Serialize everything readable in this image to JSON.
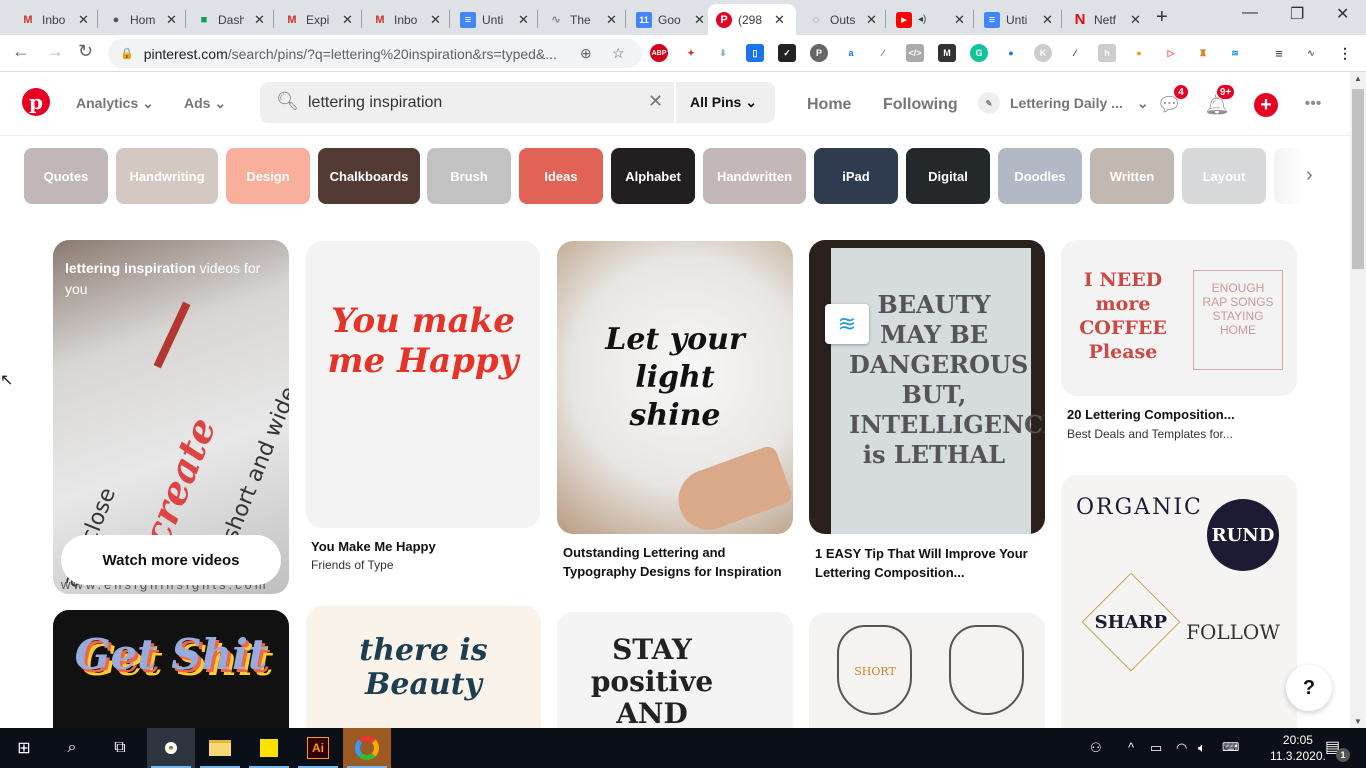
{
  "browser": {
    "tabs": [
      {
        "title": "Inbo",
        "icon": "gmail-icon"
      },
      {
        "title": "Hom",
        "icon": "globe-icon"
      },
      {
        "title": "Dash",
        "icon": "chat-icon"
      },
      {
        "title": "Expi",
        "icon": "gmail-icon"
      },
      {
        "title": "Inbo",
        "icon": "gmail-icon"
      },
      {
        "title": "Unti",
        "icon": "docs-icon"
      },
      {
        "title": "The",
        "icon": "site-icon"
      },
      {
        "title": "Goo",
        "icon": "calendar-icon"
      },
      {
        "title": "(298",
        "icon": "pinterest-icon",
        "active": true
      },
      {
        "title": "Outs",
        "icon": "loading-icon"
      },
      {
        "title": "",
        "icon": "youtube-icon",
        "audio": true
      },
      {
        "title": "Unti",
        "icon": "docs-icon"
      },
      {
        "title": "Netf",
        "icon": "netflix-icon"
      }
    ],
    "calendar_day": "11",
    "url_host": "pinterest.com",
    "url_path": "/search/pins/?q=lettering%20inspiration&rs=typed&...",
    "extensions": [
      "ABP",
      "extension",
      "download",
      "extension",
      "check",
      "pinterest",
      "extension",
      "eyedropper",
      "code",
      "M",
      "G",
      "cookie",
      "K",
      "picker",
      "h",
      "sync",
      "play",
      "extension",
      "wave"
    ]
  },
  "header": {
    "menu": [
      {
        "label": "Analytics"
      },
      {
        "label": "Ads"
      }
    ],
    "search_value": "lettering inspiration",
    "search_scope": "All Pins",
    "nav": [
      {
        "label": "Home"
      },
      {
        "label": "Following"
      }
    ],
    "account": "Lettering Daily ...",
    "messages_badge": "4",
    "notifications_badge": "9+"
  },
  "guides": [
    {
      "label": "Quotes",
      "color": "#c1b7b9"
    },
    {
      "label": "Handwriting",
      "color": "#d3c9c2"
    },
    {
      "label": "Design",
      "color": "#f8b09c"
    },
    {
      "label": "Chalkboards",
      "color": "#533a34"
    },
    {
      "label": "Brush",
      "color": "#c2c2c2"
    },
    {
      "label": "Ideas",
      "color": "#e06355"
    },
    {
      "label": "Alphabet",
      "color": "#231f20"
    },
    {
      "label": "Handwritten",
      "color": "#c3b7b7"
    },
    {
      "label": "iPad",
      "color": "#2f3c4f"
    },
    {
      "label": "Digital",
      "color": "#23282b"
    },
    {
      "label": "Doodles",
      "color": "#b3b8c6"
    },
    {
      "label": "Written",
      "color": "#c0b8b1"
    },
    {
      "label": "Layout",
      "color": "#d6d8d9"
    }
  ],
  "pins": {
    "video_card": {
      "title_bold": "lettering inspiration",
      "title_rest": " videos for you",
      "button": "Watch more videos",
      "image_text": [
        "tall and close",
        "create",
        "short and wide"
      ],
      "watermark": "www.ensigninsights.com"
    },
    "items": [
      {
        "title": "You Make Me Happy",
        "subtitle": "Friends of Type",
        "art": "You make me Happy"
      },
      {
        "title": "Outstanding Lettering and Typography Designs for Inspiration",
        "subtitle": "",
        "art": "Let your light shine"
      },
      {
        "title": "1 EASY Tip That Will Improve Your Lettering Composition...",
        "subtitle": "",
        "art": "BEAUTY MAY BE DANGEROUS BUT, INTELLIGENCE is LETHAL"
      },
      {
        "title": "20 Lettering Composition...",
        "subtitle": "Best Deals and Templates for...",
        "art": "I NEED more COFFEE Please"
      },
      {
        "title": "",
        "subtitle": "",
        "art": "ORGANIC ROUND SHARP FOLLOW"
      },
      {
        "title": "",
        "subtitle": "",
        "art": "Get Shit"
      },
      {
        "title": "",
        "subtitle": "",
        "art": "there is Beauty"
      },
      {
        "title": "",
        "subtitle": "",
        "art": "STAY positive AND GOOD"
      },
      {
        "title": "",
        "subtitle": "",
        "art": "SHORT"
      }
    ]
  },
  "help_label": "?",
  "taskbar": {
    "apps": [
      "start",
      "search",
      "task-view",
      "chrome",
      "file-explorer",
      "sticky-notes",
      "illustrator",
      "firefox-like"
    ],
    "time": "20:05",
    "date": "11.3.2020.",
    "notifications": "1"
  }
}
